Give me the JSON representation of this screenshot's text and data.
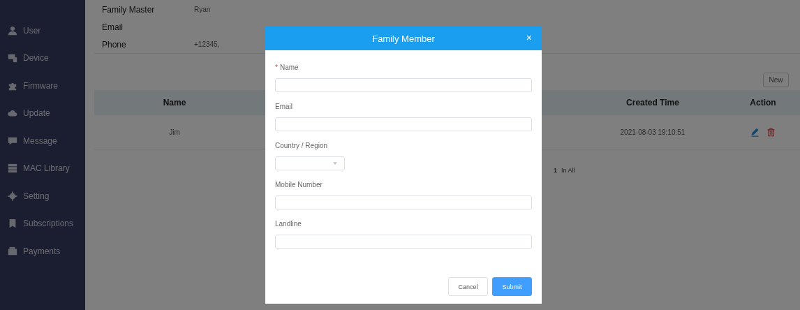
{
  "sidebar": {
    "items": [
      {
        "label": "User"
      },
      {
        "label": "Device"
      },
      {
        "label": "Firmware"
      },
      {
        "label": "Update"
      },
      {
        "label": "Message"
      },
      {
        "label": "MAC Library"
      },
      {
        "label": "Setting"
      },
      {
        "label": "Subscriptions"
      },
      {
        "label": "Payments"
      }
    ]
  },
  "info": [
    {
      "label": "Family Master",
      "value": "Ryan"
    },
    {
      "label": "Email"
    },
    {
      "label": "Phone",
      "value": "+12345,"
    }
  ],
  "new_button": "New",
  "table": {
    "columns": [
      "Name",
      "Created Time",
      "Action"
    ],
    "rows": [
      {
        "name": "Jim",
        "created_time": "2021-08-03 19:10:51"
      }
    ]
  },
  "pagination": {
    "count": "1",
    "suffix": "In All"
  },
  "dialog": {
    "title": "Family Member",
    "close": "×",
    "required_mark": "*",
    "fields": [
      {
        "kind": "text",
        "label": "Name",
        "required": true
      },
      {
        "kind": "text",
        "label": "Email",
        "required": false
      },
      {
        "kind": "select",
        "label": "Country / Region",
        "required": false
      },
      {
        "kind": "text",
        "label": "Mobile Number",
        "required": false
      },
      {
        "kind": "text",
        "label": "Landline",
        "required": false
      }
    ],
    "buttons": [
      {
        "label": "Cancel",
        "primary": false
      },
      {
        "label": "Submit",
        "primary": true
      }
    ]
  }
}
